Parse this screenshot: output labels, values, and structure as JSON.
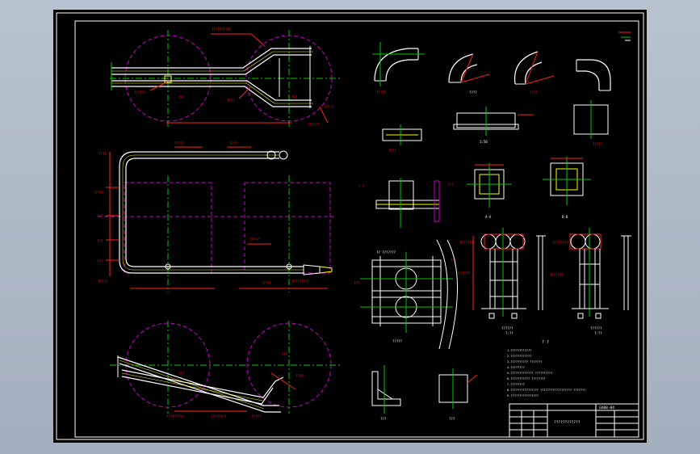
{
  "colors": {
    "background": "#000000",
    "frame": "#ffffff",
    "centerline": "#00c800",
    "dimension": "#ff1e1e",
    "construction": "#c800c8",
    "part": "#ffffff",
    "label": "#ffff00",
    "viewport": "#a9b4c2"
  },
  "title_block": {
    "drawing_number": "GX08-04",
    "title": "????????????"
  },
  "notes": {
    "heading": "? ?",
    "lines": [
      "1.????????????",
      "2.????????????",
      "3.?????????? ???????",
      "4.????????",
      "5.????????????? ??????????",
      "6.??????????? ????????",
      "7.????????",
      "8.???????????????? ?????????????????? ???????",
      "9.????????????????"
    ]
  },
  "view_labels": {
    "scale_1_50": "1:50",
    "section_a": "A-A",
    "section_b": "B-B"
  }
}
